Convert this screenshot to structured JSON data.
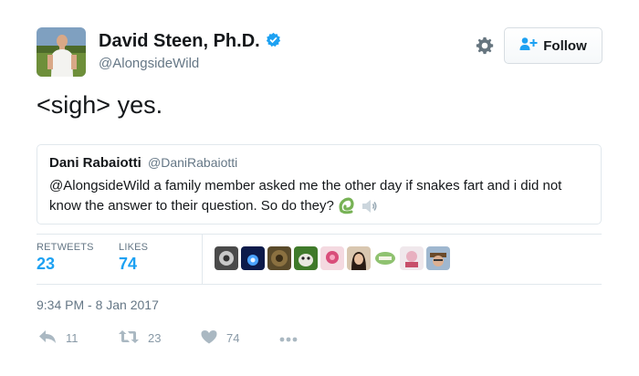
{
  "tweet": {
    "author_name": "David Steen, Ph.D.",
    "author_handle": "@AlongsideWild",
    "verified": true,
    "follow_label": "Follow",
    "text": "<sigh> yes.",
    "timestamp": "9:34 PM - 8 Jan 2017"
  },
  "quoted": {
    "name": "Dani Rabaiotti",
    "handle": "@DaniRabaiotti",
    "text": "@AlongsideWild a family member asked me the other day if snakes fart and i did not know the answer to their question. So do they?"
  },
  "stats": {
    "retweets_label": "RETWEETS",
    "retweets": "23",
    "likes_label": "LIKES",
    "likes": "74"
  },
  "actions": {
    "reply_count": "11",
    "retweet_count": "23",
    "like_count": "74"
  },
  "icons": [
    "gear-icon",
    "add-user-icon",
    "verified-badge-icon",
    "snake-emoji-icon",
    "speaker-emoji-icon",
    "reply-icon",
    "retweet-icon",
    "heart-icon",
    "more-icon"
  ],
  "colors": {
    "accent": "#1da1f2",
    "muted": "#657786",
    "action_gray": "#8899a6",
    "border": "#e1e8ed"
  }
}
